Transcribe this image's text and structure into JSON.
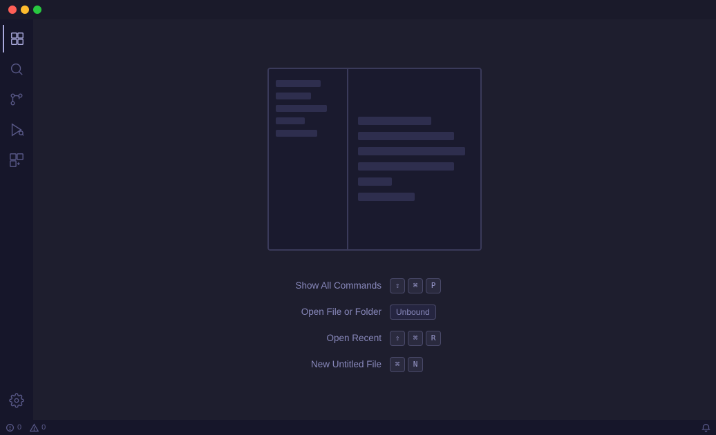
{
  "titlebar": {
    "traffic_lights": {
      "close_color": "#ff5f57",
      "minimize_color": "#febc2e",
      "maximize_color": "#28c840"
    }
  },
  "sidebar": {
    "icons": [
      {
        "name": "files-icon",
        "label": "Explorer",
        "active": true
      },
      {
        "name": "search-icon",
        "label": "Search"
      },
      {
        "name": "source-control-icon",
        "label": "Source Control"
      },
      {
        "name": "run-icon",
        "label": "Run and Debug"
      },
      {
        "name": "extensions-icon",
        "label": "Extensions"
      }
    ],
    "bottom_icons": [
      {
        "name": "settings-icon",
        "label": "Settings"
      }
    ]
  },
  "shortcuts": [
    {
      "label": "Show All Commands",
      "keys": [
        "⇧",
        "⌘",
        "P"
      ],
      "type": "combo"
    },
    {
      "label": "Open File or Folder",
      "keys": [
        "Unbound"
      ],
      "type": "unbound"
    },
    {
      "label": "Open Recent",
      "keys": [
        "⇧",
        "⌘",
        "R"
      ],
      "type": "combo"
    },
    {
      "label": "New Untitled File",
      "keys": [
        "⌘",
        "N"
      ],
      "type": "combo"
    }
  ],
  "statusbar": {
    "errors": "0",
    "warnings": "0",
    "error_icon": "error-icon",
    "warning_icon": "warning-icon",
    "bell_icon": "bell-icon"
  }
}
